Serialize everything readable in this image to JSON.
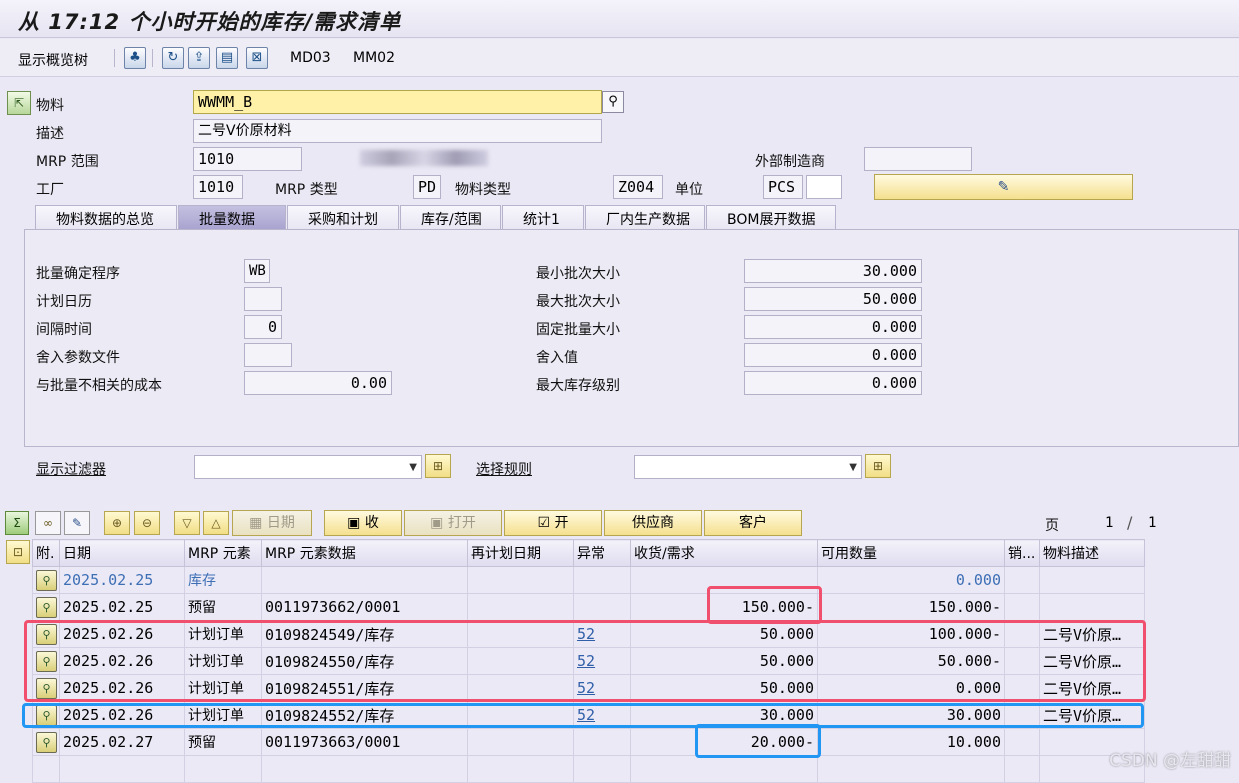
{
  "window": {
    "title": "从 17:12 个小时开始的库存/需求清单"
  },
  "toolbar": {
    "show_overview": "显示概览树",
    "md03": "MD03",
    "mm02": "MM02",
    "icons": [
      "hierarchy-icon",
      "refresh-icon",
      "refresh-up-icon",
      "document-icon"
    ]
  },
  "header": {
    "material_label": "物料",
    "material_value": "WWMM_B",
    "desc_label": "描述",
    "desc_value": "二号V价原材料",
    "mrp_area_label": "MRP 范围",
    "mrp_area_value": "1010",
    "ext_mfr_label": "外部制造商",
    "ext_mfr_value": "",
    "plant_label": "工厂",
    "plant_value": "1010",
    "mrp_type_label": "MRP 类型",
    "mrp_type_value": "PD",
    "mat_type_label": "物料类型",
    "mat_type_value": "Z004",
    "unit_label": "单位",
    "unit_value": "PCS"
  },
  "tabs": [
    "物料数据的总览",
    "批量数据",
    "采购和计划",
    "库存/范围",
    "统计1",
    "厂内生产数据",
    "BOM展开数据"
  ],
  "active_tab": "批量数据",
  "lot_data": {
    "left": [
      {
        "label": "批量确定程序",
        "value": "WB"
      },
      {
        "label": "计划日历",
        "value": ""
      },
      {
        "label": "间隔时间",
        "value": "0"
      },
      {
        "label": "舍入参数文件",
        "value": ""
      },
      {
        "label": "与批量不相关的成本",
        "value": "0.00"
      }
    ],
    "right": [
      {
        "label": "最小批次大小",
        "value": "30.000"
      },
      {
        "label": "最大批次大小",
        "value": "50.000"
      },
      {
        "label": "固定批量大小",
        "value": "0.000"
      },
      {
        "label": "舍入值",
        "value": "0.000"
      },
      {
        "label": "最大库存级别",
        "value": "0.000"
      }
    ]
  },
  "filters": {
    "display_filter": "显示过滤器",
    "select_rule": "选择规则"
  },
  "grid_toolbar": {
    "date": "日期",
    "receipt": "收",
    "open": "打开",
    "open2": "开",
    "vendor": "供应商",
    "customer": "客户",
    "page_label": "页",
    "page_current": "1",
    "page_total": "1"
  },
  "grid": {
    "columns": [
      "附.",
      "日期",
      "MRP 元素",
      "MRP 元素数据",
      "再计划日期",
      "异常",
      "收货/需求",
      "可用数量",
      "销...",
      "物料描述"
    ],
    "rows": [
      {
        "date": "2025.02.25",
        "element": "库存",
        "data": "",
        "reschedule": "",
        "exception": "",
        "qty": "",
        "available": "0.000",
        "sales": "",
        "desc": "",
        "highlight": true
      },
      {
        "date": "2025.02.25",
        "element": "预留",
        "data": "0011973662/0001",
        "reschedule": "",
        "exception": "",
        "qty": "150.000-",
        "available": "150.000-",
        "sales": "",
        "desc": ""
      },
      {
        "date": "2025.02.26",
        "element": "计划订单",
        "data": "0109824549/库存",
        "reschedule": "",
        "exception": "52",
        "qty": "50.000",
        "available": "100.000-",
        "sales": "",
        "desc": "二号V价原…"
      },
      {
        "date": "2025.02.26",
        "element": "计划订单",
        "data": "0109824550/库存",
        "reschedule": "",
        "exception": "52",
        "qty": "50.000",
        "available": "50.000-",
        "sales": "",
        "desc": "二号V价原…"
      },
      {
        "date": "2025.02.26",
        "element": "计划订单",
        "data": "0109824551/库存",
        "reschedule": "",
        "exception": "52",
        "qty": "50.000",
        "available": "0.000",
        "sales": "",
        "desc": "二号V价原…"
      },
      {
        "date": "2025.02.26",
        "element": "计划订单",
        "data": "0109824552/库存",
        "reschedule": "",
        "exception": "52",
        "qty": "30.000",
        "available": "30.000",
        "sales": "",
        "desc": "二号V价原…"
      },
      {
        "date": "2025.02.27",
        "element": "预留",
        "data": "0011973663/0001",
        "reschedule": "",
        "exception": "",
        "qty": "20.000-",
        "available": "10.000",
        "sales": "",
        "desc": ""
      }
    ]
  },
  "annotation_colors": {
    "red": "#f0506e",
    "blue": "#2196f3"
  },
  "watermark": "CSDN @左甜甜"
}
